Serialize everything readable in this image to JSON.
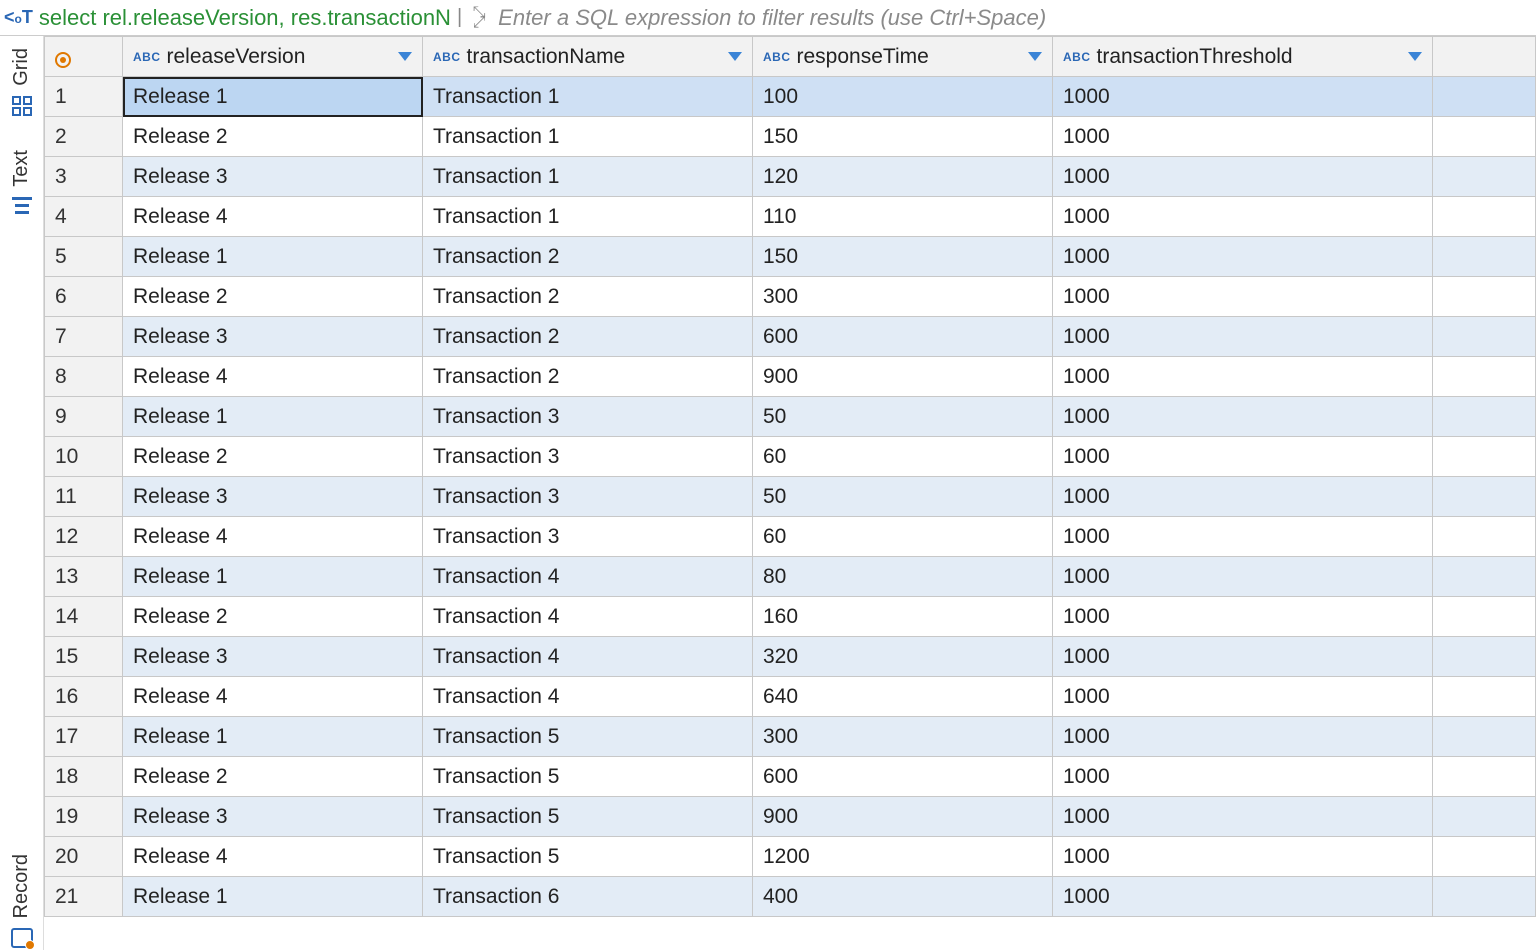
{
  "topbar": {
    "sql_text": "select rel.releaseVersion, res.transactionN",
    "filter_placeholder": "Enter a SQL expression to filter results (use Ctrl+Space)"
  },
  "sideTabs": {
    "grid": "Grid",
    "text": "Text",
    "record": "Record"
  },
  "columns": [
    {
      "type": "abc",
      "label": "releaseVersion"
    },
    {
      "type": "abc",
      "label": "transactionName"
    },
    {
      "type": "abc",
      "label": "responseTime"
    },
    {
      "type": "abc",
      "label": "transactionThreshold"
    }
  ],
  "rows": [
    {
      "n": "1",
      "c": [
        "Release 1",
        "Transaction 1",
        "100",
        "1000"
      ]
    },
    {
      "n": "2",
      "c": [
        "Release 2",
        "Transaction 1",
        "150",
        "1000"
      ]
    },
    {
      "n": "3",
      "c": [
        "Release 3",
        "Transaction 1",
        "120",
        "1000"
      ]
    },
    {
      "n": "4",
      "c": [
        "Release 4",
        "Transaction 1",
        "110",
        "1000"
      ]
    },
    {
      "n": "5",
      "c": [
        "Release 1",
        "Transaction 2",
        "150",
        "1000"
      ]
    },
    {
      "n": "6",
      "c": [
        "Release 2",
        "Transaction 2",
        "300",
        "1000"
      ]
    },
    {
      "n": "7",
      "c": [
        "Release 3",
        "Transaction 2",
        "600",
        "1000"
      ]
    },
    {
      "n": "8",
      "c": [
        "Release 4",
        "Transaction 2",
        "900",
        "1000"
      ]
    },
    {
      "n": "9",
      "c": [
        "Release 1",
        "Transaction 3",
        "50",
        "1000"
      ]
    },
    {
      "n": "10",
      "c": [
        "Release 2",
        "Transaction 3",
        "60",
        "1000"
      ]
    },
    {
      "n": "11",
      "c": [
        "Release 3",
        "Transaction 3",
        "50",
        "1000"
      ]
    },
    {
      "n": "12",
      "c": [
        "Release 4",
        "Transaction 3",
        "60",
        "1000"
      ]
    },
    {
      "n": "13",
      "c": [
        "Release 1",
        "Transaction 4",
        "80",
        "1000"
      ]
    },
    {
      "n": "14",
      "c": [
        "Release 2",
        "Transaction 4",
        "160",
        "1000"
      ]
    },
    {
      "n": "15",
      "c": [
        "Release 3",
        "Transaction 4",
        "320",
        "1000"
      ]
    },
    {
      "n": "16",
      "c": [
        "Release 4",
        "Transaction 4",
        "640",
        "1000"
      ]
    },
    {
      "n": "17",
      "c": [
        "Release 1",
        "Transaction 5",
        "300",
        "1000"
      ]
    },
    {
      "n": "18",
      "c": [
        "Release 2",
        "Transaction 5",
        "600",
        "1000"
      ]
    },
    {
      "n": "19",
      "c": [
        "Release 3",
        "Transaction 5",
        "900",
        "1000"
      ]
    },
    {
      "n": "20",
      "c": [
        "Release 4",
        "Transaction 5",
        "1200",
        "1000"
      ]
    },
    {
      "n": "21",
      "c": [
        "Release 1",
        "Transaction 6",
        "400",
        "1000"
      ]
    }
  ],
  "selectedRow": 0
}
